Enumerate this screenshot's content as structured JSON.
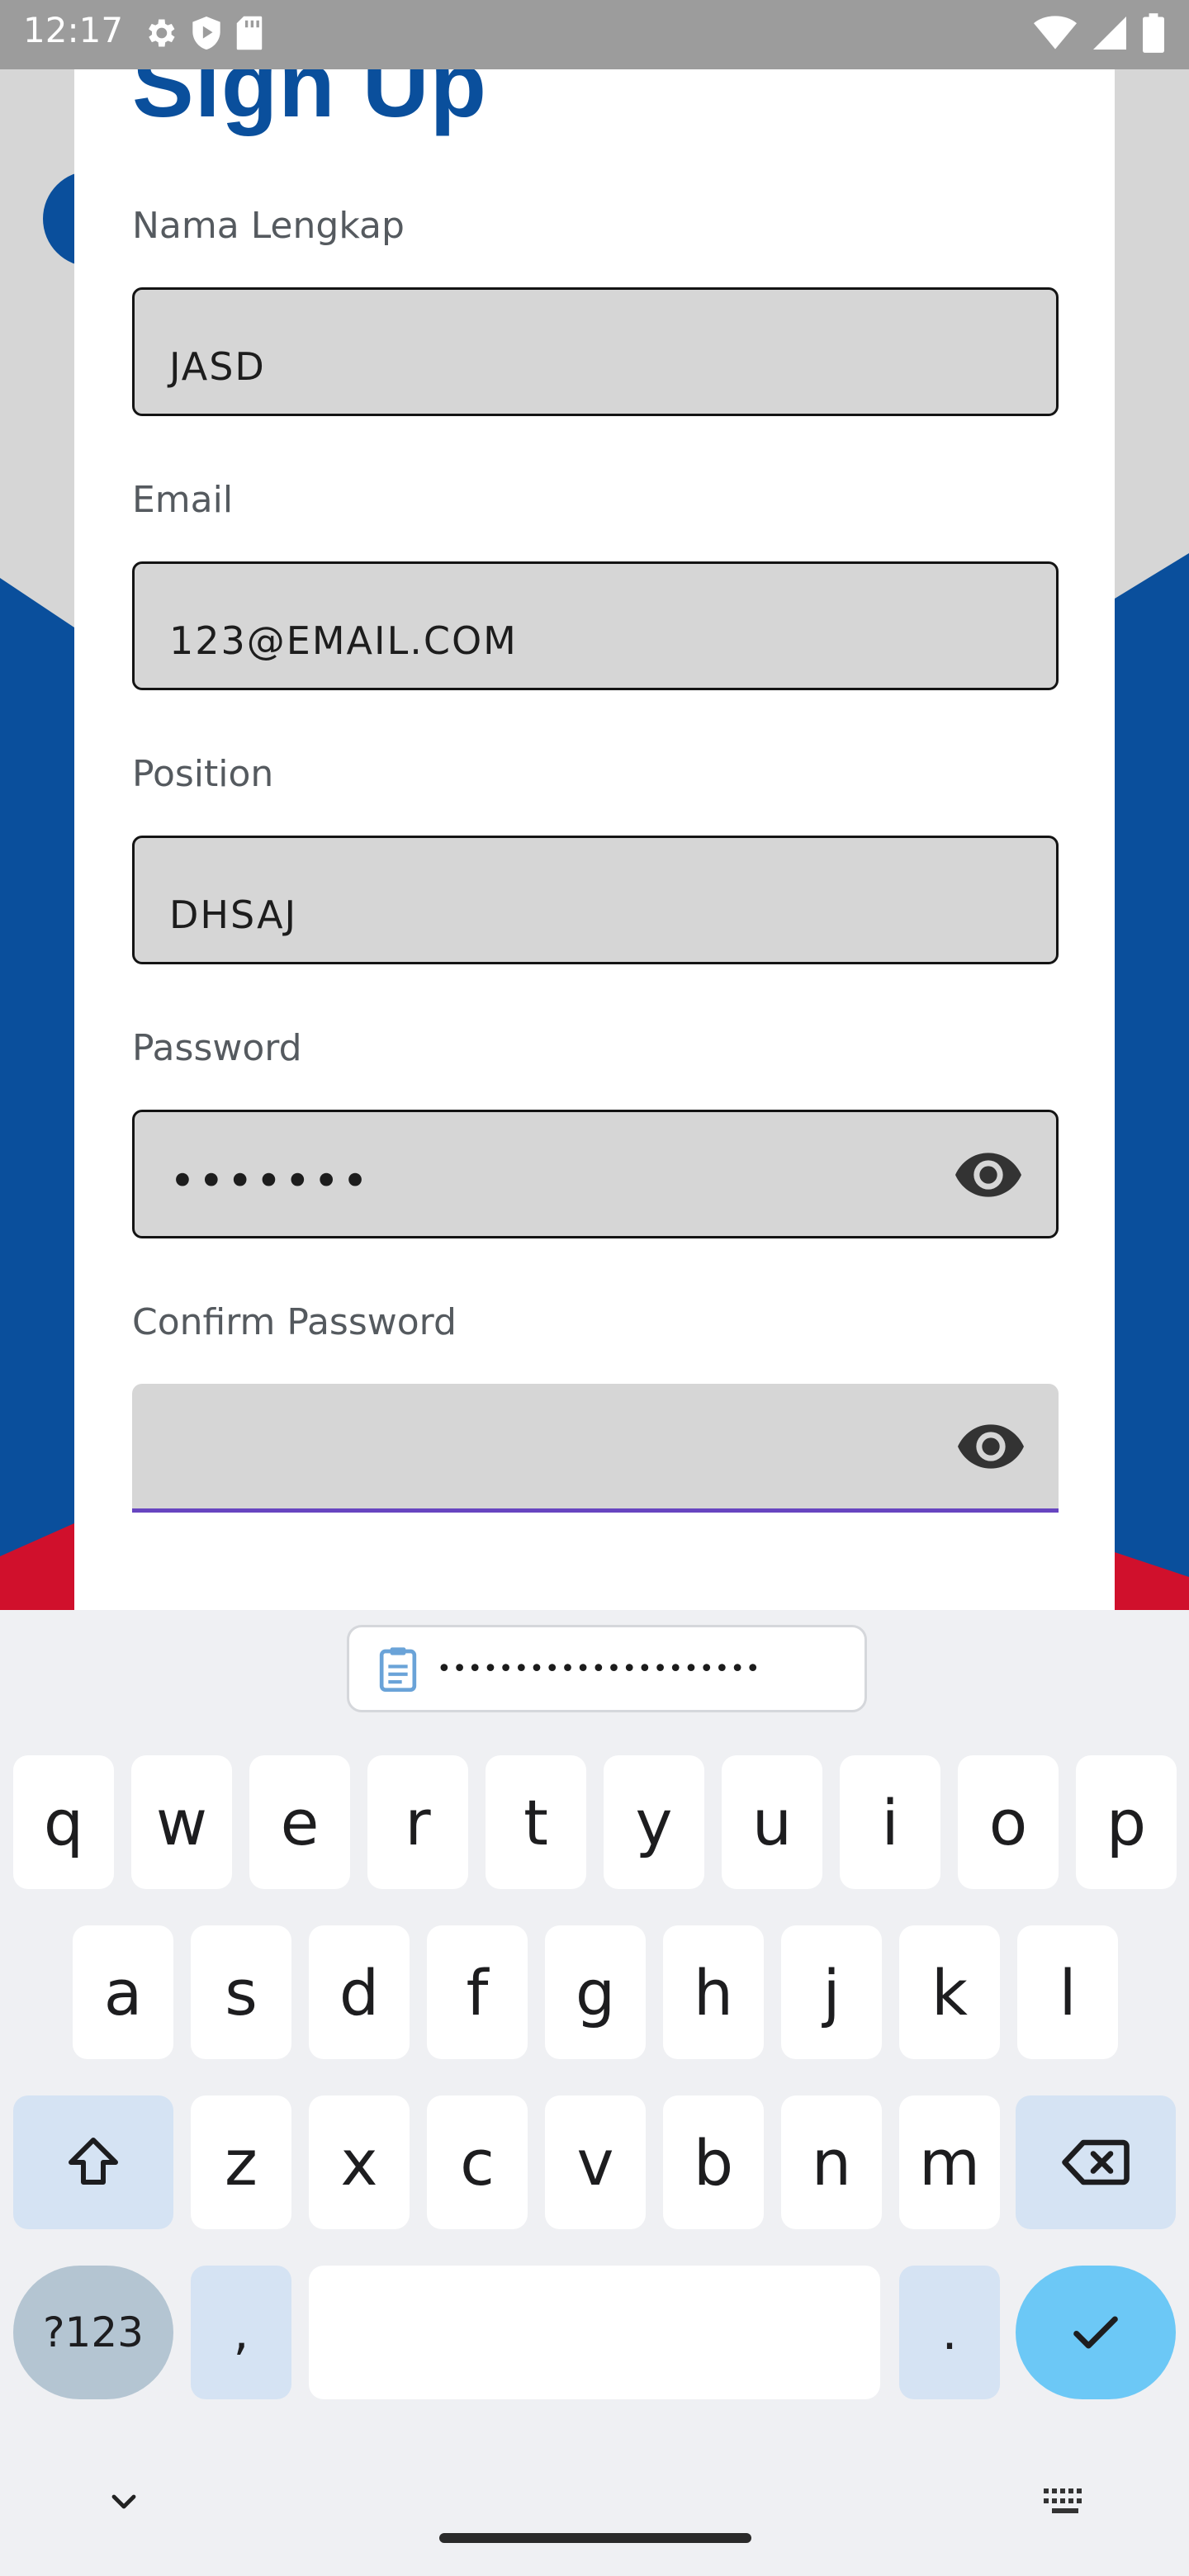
{
  "status_bar": {
    "time": "12:17",
    "left_icons": [
      "gear-icon",
      "play-protect-icon",
      "sd-card-icon"
    ],
    "right_icons": [
      "wifi-icon",
      "cellular-signal-icon",
      "battery-icon"
    ]
  },
  "colors": {
    "brand_blue": "#0a4f9c",
    "brand_red": "#d0102c",
    "focus_purple": "#6745c0",
    "enter_key": "#6cc8f6"
  },
  "form": {
    "title": "Sign Up",
    "fields": [
      {
        "label": "Nama Lengkap",
        "value": "JASD"
      },
      {
        "label": "Email",
        "value": "123@EMAIL.COM"
      },
      {
        "label": "Position",
        "value": "DHSAJ"
      },
      {
        "label": "Password",
        "value": "•••••••",
        "icon": "eye-icon"
      },
      {
        "label": "Confirm Password",
        "value": "",
        "icon": "eye-icon",
        "focused": true
      }
    ]
  },
  "keyboard": {
    "clipboard_suggestion": "•••••••••••••••••••••",
    "row1": [
      "q",
      "w",
      "e",
      "r",
      "t",
      "y",
      "u",
      "i",
      "o",
      "p"
    ],
    "row2": [
      "a",
      "s",
      "d",
      "f",
      "g",
      "h",
      "j",
      "k",
      "l"
    ],
    "row3": [
      "z",
      "x",
      "c",
      "v",
      "b",
      "n",
      "m"
    ],
    "symbols_key": "?123",
    "comma_key": ",",
    "period_key": ".",
    "shift_icon": "shift-icon",
    "backspace_icon": "backspace-icon",
    "enter_icon": "checkmark-icon"
  },
  "nav_bar": {
    "back_icon": "chevron-down-icon",
    "switch_keyboard_icon": "keyboard-icon"
  }
}
